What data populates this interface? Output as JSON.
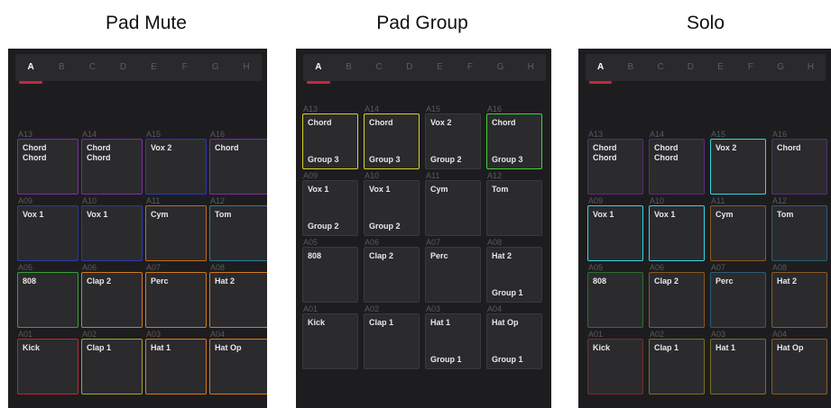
{
  "tabs": [
    "A",
    "B",
    "C",
    "D",
    "E",
    "F",
    "G",
    "H"
  ],
  "panels": [
    {
      "title": "Pad Mute",
      "pads": [
        {
          "id": "A13",
          "line1": "Chord",
          "line2": "Chord",
          "group": "",
          "color": "#7a2f9e"
        },
        {
          "id": "A14",
          "line1": "Chord",
          "line2": "Chord",
          "group": "",
          "color": "#7a2f9e"
        },
        {
          "id": "A15",
          "line1": "Vox 2",
          "line2": "",
          "group": "",
          "color": "#2c3aa8"
        },
        {
          "id": "A16",
          "line1": "Chord",
          "line2": "",
          "group": "",
          "color": "#7a2f9e"
        },
        {
          "id": "A09",
          "line1": "Vox 1",
          "line2": "",
          "group": "",
          "color": "#2c3aa8"
        },
        {
          "id": "A10",
          "line1": "Vox 1",
          "line2": "",
          "group": "",
          "color": "#2c3aa8"
        },
        {
          "id": "A11",
          "line1": "Cym",
          "line2": "",
          "group": "",
          "color": "#c06a1e"
        },
        {
          "id": "A12",
          "line1": "Tom",
          "line2": "",
          "group": "",
          "color": "#2a7f99"
        },
        {
          "id": "A05",
          "line1": "808",
          "line2": "",
          "group": "",
          "color": "#3aa036"
        },
        {
          "id": "A06",
          "line1": "Clap 2",
          "line2": "",
          "group": "",
          "color": "#d47a1e"
        },
        {
          "id": "A07",
          "line1": "Perc",
          "line2": "",
          "group": "",
          "color": "#d47a1e"
        },
        {
          "id": "A08",
          "line1": "Hat 2",
          "line2": "",
          "group": "",
          "color": "#d47a1e"
        },
        {
          "id": "A01",
          "line1": "Kick",
          "line2": "",
          "group": "",
          "color": "#b22a32"
        },
        {
          "id": "A02",
          "line1": "Clap 1",
          "line2": "",
          "group": "",
          "color": "#a8a42a"
        },
        {
          "id": "A03",
          "line1": "Hat 1",
          "line2": "",
          "group": "",
          "color": "#d47a1e"
        },
        {
          "id": "A04",
          "line1": "Hat Op",
          "line2": "",
          "group": "",
          "color": "#d47a1e"
        }
      ]
    },
    {
      "title": "Pad Group",
      "pads": [
        {
          "id": "A13",
          "line1": "Chord",
          "line2": "",
          "group": "Group 3",
          "color": "#d8d22a"
        },
        {
          "id": "A14",
          "line1": "Chord",
          "line2": "",
          "group": "Group 3",
          "color": "#d8d22a"
        },
        {
          "id": "A15",
          "line1": "Vox 2",
          "line2": "",
          "group": "Group 2",
          "color": "#3a3a3e"
        },
        {
          "id": "A16",
          "line1": "Chord",
          "line2": "",
          "group": "Group 3",
          "color": "#3ed13a"
        },
        {
          "id": "A09",
          "line1": "Vox 1",
          "line2": "",
          "group": "Group 2",
          "color": "#3a3a3e"
        },
        {
          "id": "A10",
          "line1": "Vox 1",
          "line2": "",
          "group": "Group 2",
          "color": "#3a3a3e"
        },
        {
          "id": "A11",
          "line1": "Cym",
          "line2": "",
          "group": "",
          "color": "#3a3a3e"
        },
        {
          "id": "A12",
          "line1": "Tom",
          "line2": "",
          "group": "",
          "color": "#3a3a3e"
        },
        {
          "id": "A05",
          "line1": "808",
          "line2": "",
          "group": "",
          "color": "#3a3a3e"
        },
        {
          "id": "A06",
          "line1": "Clap 2",
          "line2": "",
          "group": "",
          "color": "#3a3a3e"
        },
        {
          "id": "A07",
          "line1": "Perc",
          "line2": "",
          "group": "",
          "color": "#3a3a3e"
        },
        {
          "id": "A08",
          "line1": "Hat 2",
          "line2": "",
          "group": "Group 1",
          "color": "#3a3a3e"
        },
        {
          "id": "A01",
          "line1": "Kick",
          "line2": "",
          "group": "",
          "color": "#3a3a3e"
        },
        {
          "id": "A02",
          "line1": "Clap 1",
          "line2": "",
          "group": "",
          "color": "#3a3a3e"
        },
        {
          "id": "A03",
          "line1": "Hat 1",
          "line2": "",
          "group": "Group 1",
          "color": "#3a3a3e"
        },
        {
          "id": "A04",
          "line1": "Hat Op",
          "line2": "",
          "group": "Group 1",
          "color": "#3a3a3e"
        }
      ]
    },
    {
      "title": "Solo",
      "pads": [
        {
          "id": "A13",
          "line1": "Chord",
          "line2": "Chord",
          "group": "",
          "color": "#5a2d72"
        },
        {
          "id": "A14",
          "line1": "Chord",
          "line2": "Chord",
          "group": "",
          "color": "#5a2d72"
        },
        {
          "id": "A15",
          "line1": "Vox 2",
          "line2": "",
          "group": "",
          "color": "#39d6e0"
        },
        {
          "id": "A16",
          "line1": "Chord",
          "line2": "",
          "group": "",
          "color": "#5a2d72"
        },
        {
          "id": "A09",
          "line1": "Vox 1",
          "line2": "",
          "group": "",
          "color": "#39d6e0"
        },
        {
          "id": "A10",
          "line1": "Vox 1",
          "line2": "",
          "group": "",
          "color": "#39d6e0"
        },
        {
          "id": "A11",
          "line1": "Cym",
          "line2": "",
          "group": "",
          "color": "#8a5a22"
        },
        {
          "id": "A12",
          "line1": "Tom",
          "line2": "",
          "group": "",
          "color": "#2a5d75"
        },
        {
          "id": "A05",
          "line1": "808",
          "line2": "",
          "group": "",
          "color": "#2f6e2e"
        },
        {
          "id": "A06",
          "line1": "Clap 2",
          "line2": "",
          "group": "",
          "color": "#8a5a22"
        },
        {
          "id": "A07",
          "line1": "Perc",
          "line2": "",
          "group": "",
          "color": "#2a5d75"
        },
        {
          "id": "A08",
          "line1": "Hat 2",
          "line2": "",
          "group": "",
          "color": "#8a5a22"
        },
        {
          "id": "A01",
          "line1": "Kick",
          "line2": "",
          "group": "",
          "color": "#7a2a2e"
        },
        {
          "id": "A02",
          "line1": "Clap 1",
          "line2": "",
          "group": "",
          "color": "#7a6e24"
        },
        {
          "id": "A03",
          "line1": "Hat 1",
          "line2": "",
          "group": "",
          "color": "#7a6e24"
        },
        {
          "id": "A04",
          "line1": "Hat Op",
          "line2": "",
          "group": "",
          "color": "#8a5a22"
        }
      ]
    }
  ]
}
